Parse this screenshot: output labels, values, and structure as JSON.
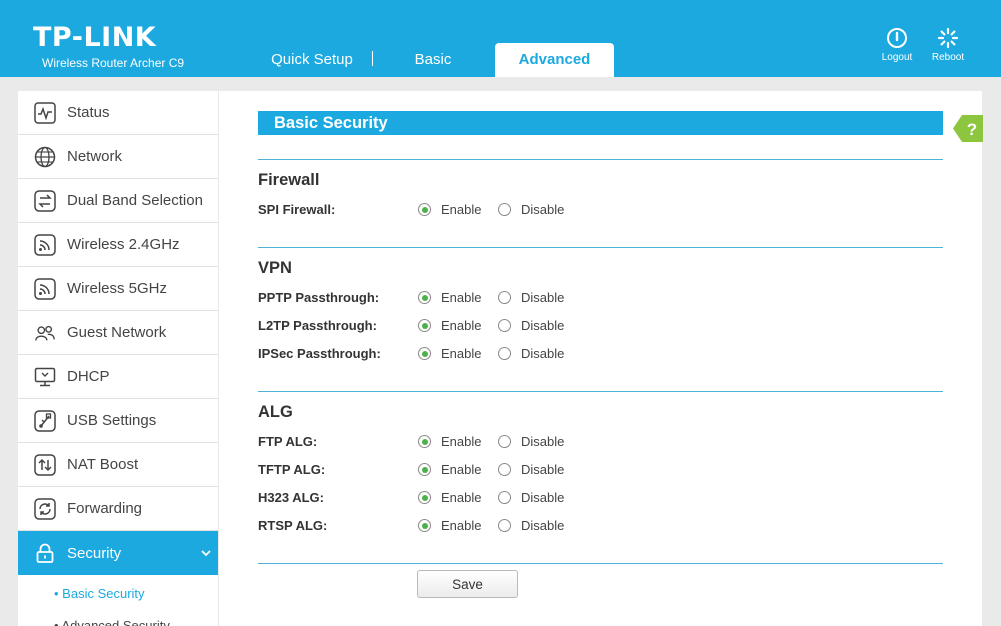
{
  "header": {
    "logo": "TP-LINK",
    "model": "Wireless Router Archer C9",
    "tabs": {
      "quick_setup": "Quick Setup",
      "basic": "Basic",
      "advanced": "Advanced"
    },
    "logout": "Logout",
    "reboot": "Reboot",
    "accent_color": "#1ba9df"
  },
  "sidebar": {
    "items": {
      "status": "Status",
      "network": "Network",
      "dual_band": "Dual Band Selection",
      "wireless24": "Wireless 2.4GHz",
      "wireless5": "Wireless 5GHz",
      "guest": "Guest Network",
      "dhcp": "DHCP",
      "usb": "USB Settings",
      "nat": "NAT Boost",
      "forwarding": "Forwarding",
      "security": "Security"
    },
    "sub": {
      "basic_security": "• Basic Security",
      "advanced_security": "• Advanced Security"
    }
  },
  "main": {
    "title": "Basic Security",
    "enable_label": "Enable",
    "disable_label": "Disable",
    "firewall": {
      "title": "Firewall",
      "spi": "SPI Firewall:",
      "spi_value": "Enable"
    },
    "vpn": {
      "title": "VPN",
      "pptp": "PPTP Passthrough:",
      "pptp_value": "Enable",
      "l2tp": "L2TP Passthrough:",
      "l2tp_value": "Enable",
      "ipsec": "IPSec Passthrough:",
      "ipsec_value": "Enable"
    },
    "alg": {
      "title": "ALG",
      "ftp": "FTP ALG:",
      "ftp_value": "Enable",
      "tftp": "TFTP ALG:",
      "tftp_value": "Enable",
      "h323": "H323 ALG:",
      "h323_value": "Enable",
      "rtsp": "RTSP ALG:",
      "rtsp_value": "Enable"
    },
    "save": "Save",
    "help": "?"
  }
}
